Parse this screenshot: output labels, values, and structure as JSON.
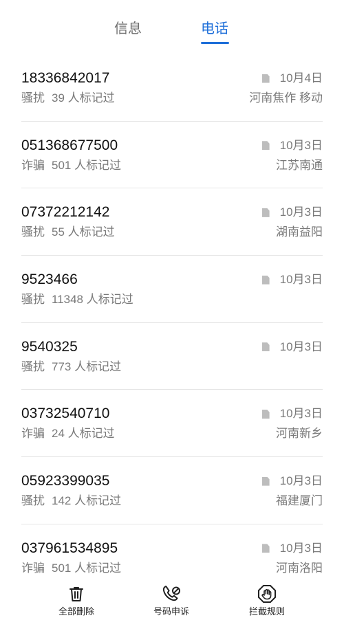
{
  "tabs": {
    "messages_label": "信息",
    "calls_label": "电话",
    "active": "calls",
    "accent_color": "#1e6fd9"
  },
  "calls": [
    {
      "number": "18336842017",
      "type": "骚扰",
      "marked": "39 人标记过",
      "date": "10月4日",
      "location": "河南焦作 移动"
    },
    {
      "number": "051368677500",
      "type": "诈骗",
      "marked": "501 人标记过",
      "date": "10月3日",
      "location": "江苏南通"
    },
    {
      "number": "07372212142",
      "type": "骚扰",
      "marked": "55 人标记过",
      "date": "10月3日",
      "location": "湖南益阳"
    },
    {
      "number": "9523466",
      "type": "骚扰",
      "marked": "11348 人标记过",
      "date": "10月3日",
      "location": ""
    },
    {
      "number": "9540325",
      "type": "骚扰",
      "marked": "773 人标记过",
      "date": "10月3日",
      "location": ""
    },
    {
      "number": "03732540710",
      "type": "诈骗",
      "marked": "24 人标记过",
      "date": "10月3日",
      "location": "河南新乡"
    },
    {
      "number": "05923399035",
      "type": "骚扰",
      "marked": "142 人标记过",
      "date": "10月3日",
      "location": "福建厦门"
    },
    {
      "number": "037961534895",
      "type": "诈骗",
      "marked": "501 人标记过",
      "date": "10月3日",
      "location": "河南洛阳"
    }
  ],
  "sim_icon": "sim-card-icon",
  "bottom_actions": {
    "delete_all": {
      "label": "全部删除",
      "icon": "trash-icon"
    },
    "appeal": {
      "label": "号码申诉",
      "icon": "phone-appeal-icon"
    },
    "rules": {
      "label": "拦截规则",
      "icon": "hand-stop-icon"
    }
  }
}
